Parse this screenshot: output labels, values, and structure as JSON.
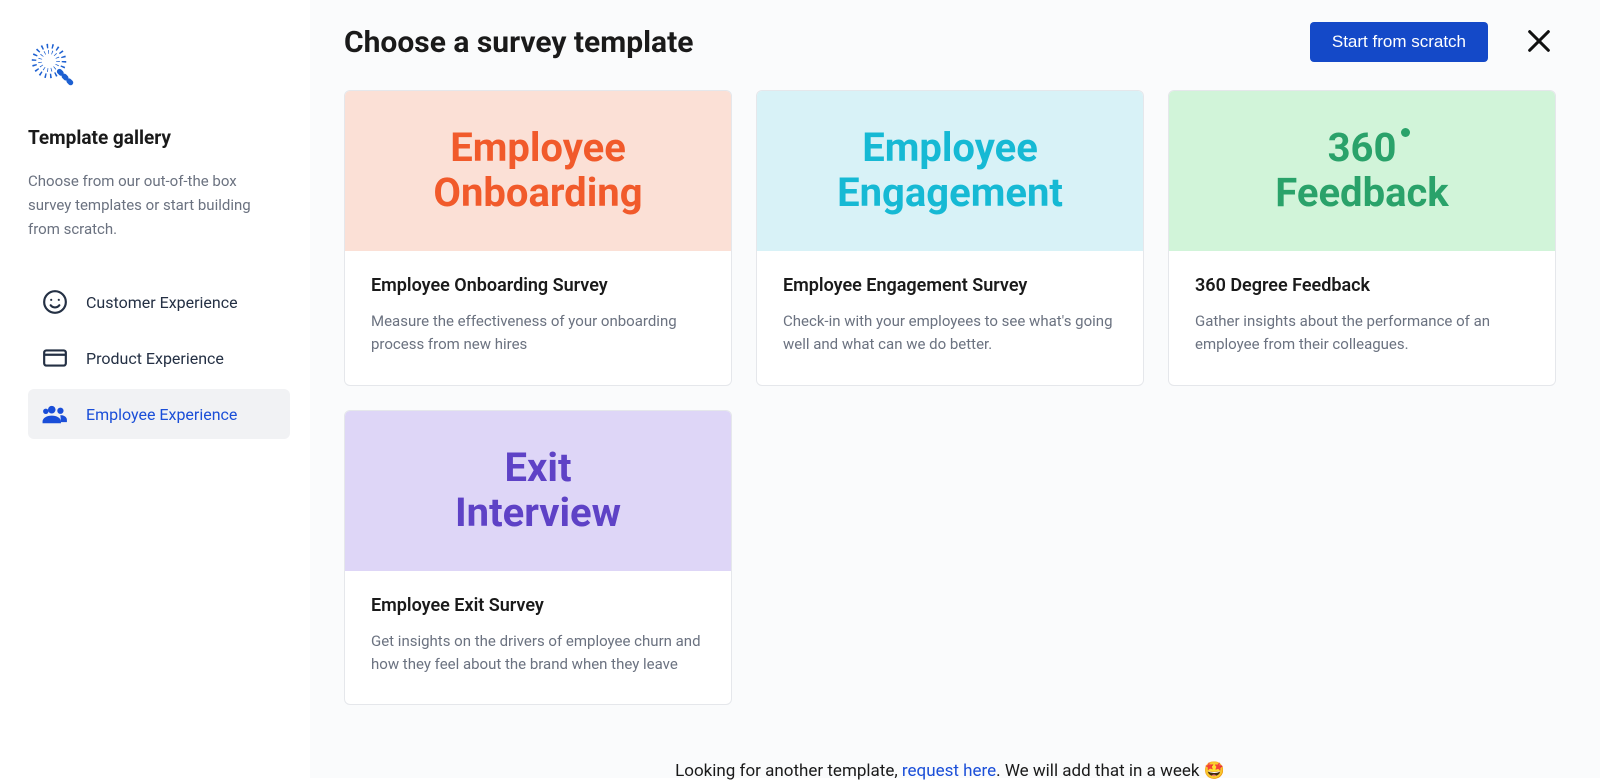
{
  "sidebar": {
    "title": "Template gallery",
    "description": "Choose from our out-of-the box survey templates or start building from scratch.",
    "items": [
      {
        "label": "Customer Experience",
        "active": false
      },
      {
        "label": "Product Experience",
        "active": false
      },
      {
        "label": "Employee Experience",
        "active": true
      }
    ]
  },
  "header": {
    "title": "Choose a survey template",
    "scratch_button": "Start from scratch"
  },
  "templates": [
    {
      "hero_line1": "Employee",
      "hero_line2": "Onboarding",
      "hero_bg": "#fbe0d6",
      "hero_fg": "#f15a2b",
      "title": "Employee Onboarding Survey",
      "description": "Measure the effectiveness of your onboarding process from new hires",
      "degree": false
    },
    {
      "hero_line1": "Employee",
      "hero_line2": "Engagement",
      "hero_bg": "#d8f2f7",
      "hero_fg": "#16b9d4",
      "title": "Employee Engagement Survey",
      "description": "Check-in with your employees to see what's going well and what can we do better.",
      "degree": false
    },
    {
      "hero_line1": "360",
      "hero_line2": "Feedback",
      "hero_bg": "#d1f4d9",
      "hero_fg": "#2aa26a",
      "title": "360 Degree Feedback",
      "description": "Gather insights about the performance of an employee from their colleagues.",
      "degree": true
    },
    {
      "hero_line1": "Exit",
      "hero_line2": "Interview",
      "hero_bg": "#ded6f7",
      "hero_fg": "#5e42c6",
      "title": "Employee Exit Survey",
      "description": "Get insights on the drivers of employee churn and how they feel about the brand when they leave",
      "degree": false
    }
  ],
  "footer": {
    "prefix": "Looking for another template, ",
    "link_text": "request here",
    "suffix": ". We will add that in a week ",
    "emoji": "🤩"
  }
}
